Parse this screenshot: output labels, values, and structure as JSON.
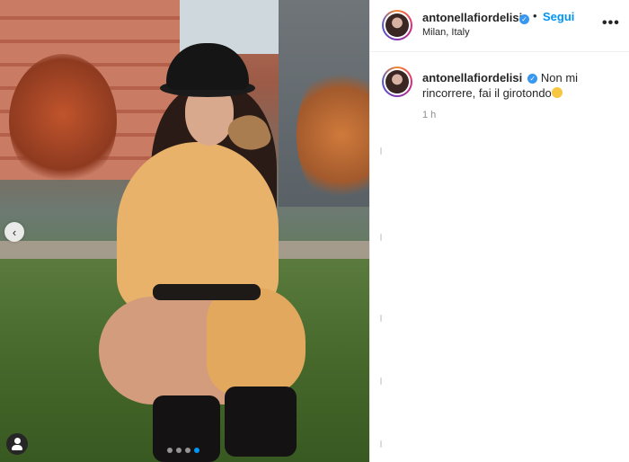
{
  "post": {
    "username": "antonellafiordelisi",
    "verified_icon": "verified-badge-icon",
    "follow_label": "Segui",
    "separator": "•",
    "location": "Milan, Italy",
    "more_label": "•••"
  },
  "caption": {
    "username": "antonellafiordelisi",
    "text": "Non mi rincorrere, fai il girotondo",
    "emoji_icon": "smiling-face-emoji",
    "time": "1 h"
  },
  "carousel": {
    "prev_label": "‹",
    "slide_count": 4,
    "active_slide": 4
  },
  "colors": {
    "link": "#0095f6",
    "verified": "#3897f0",
    "text": "#262626",
    "muted": "#8e8e8e"
  }
}
